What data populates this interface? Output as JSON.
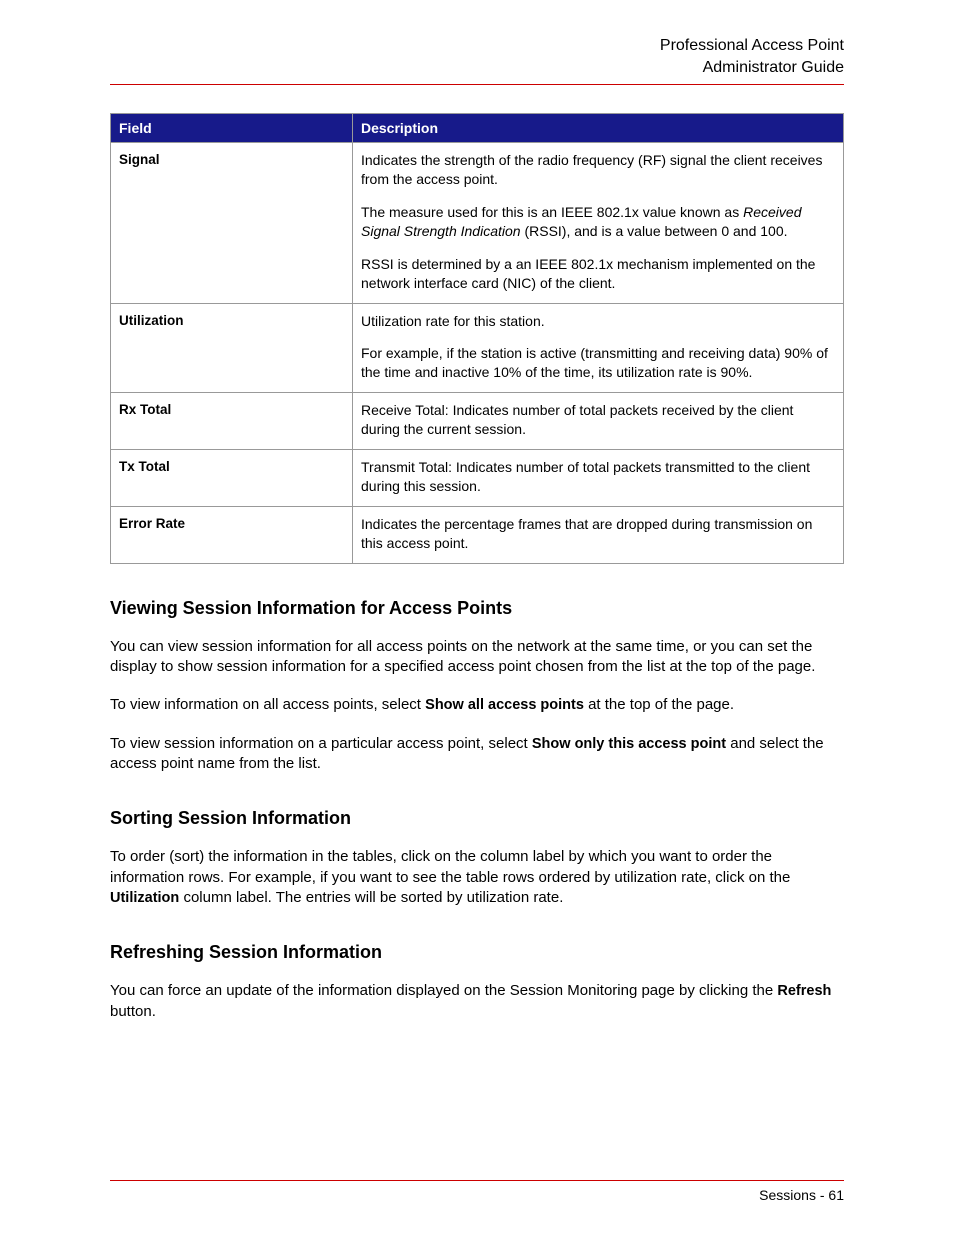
{
  "header": {
    "line1": "Professional Access Point",
    "line2": "Administrator Guide"
  },
  "table": {
    "col_field": "Field",
    "col_desc": "Description",
    "rows": [
      {
        "field": "Signal",
        "desc": [
          {
            "segments": [
              {
                "t": "Indicates the strength of the radio frequency (RF) signal the client receives from the access point."
              }
            ]
          },
          {
            "segments": [
              {
                "t": "The measure used for this is an IEEE 802.1x value known as "
              },
              {
                "t": "Received Signal Strength Indication",
                "italic": true
              },
              {
                "t": " (RSSI), and is a value between 0 and 100."
              }
            ]
          },
          {
            "segments": [
              {
                "t": "RSSI is determined by a an IEEE 802.1x mechanism implemented on the network interface card (NIC) of the client."
              }
            ]
          }
        ]
      },
      {
        "field": "Utilization",
        "desc": [
          {
            "segments": [
              {
                "t": "Utilization rate for this station."
              }
            ]
          },
          {
            "segments": [
              {
                "t": "For example, if the station is active (transmitting and receiving data) 90% of the time and inactive 10% of the time, its utilization rate is 90%."
              }
            ]
          }
        ]
      },
      {
        "field": "Rx Total",
        "desc": [
          {
            "segments": [
              {
                "t": "Receive Total: Indicates number of total packets received by the client during the current session."
              }
            ]
          }
        ]
      },
      {
        "field": "Tx Total",
        "desc": [
          {
            "segments": [
              {
                "t": "Transmit Total: Indicates number of total packets transmitted to the client during this session."
              }
            ]
          }
        ]
      },
      {
        "field": "Error Rate",
        "desc": [
          {
            "segments": [
              {
                "t": "Indicates the percentage frames that are dropped during transmission on this access point."
              }
            ]
          }
        ]
      }
    ]
  },
  "sections": [
    {
      "title": "Viewing Session Information for Access Points",
      "paras": [
        [
          {
            "t": "You can view session information for all access points on the network at the same time, or you can set the display to show session information for a specified access point chosen from the list at the top of the page."
          }
        ],
        [
          {
            "t": "To view information on all access points, select "
          },
          {
            "t": "Show all access points",
            "bold": true
          },
          {
            "t": " at the top of the page."
          }
        ],
        [
          {
            "t": "To view session information on a particular access point, select "
          },
          {
            "t": "Show only this access point",
            "bold": true
          },
          {
            "t": " and select the access point name from the list."
          }
        ]
      ]
    },
    {
      "title": "Sorting Session Information",
      "paras": [
        [
          {
            "t": "To order (sort) the information in the tables, click on the column label by which you want to order the information rows. For example, if you want to see the table rows ordered by utilization rate, click on the "
          },
          {
            "t": "Utilization",
            "bold": true
          },
          {
            "t": " column label. The entries will be sorted by utilization rate."
          }
        ]
      ]
    },
    {
      "title": "Refreshing Session Information",
      "paras": [
        [
          {
            "t": "You can force an update of the information displayed on the Session Monitoring page by clicking the "
          },
          {
            "t": "Refresh",
            "bold": true
          },
          {
            "t": " button."
          }
        ]
      ]
    }
  ],
  "footer": {
    "section": "Sessions",
    "sep": " - ",
    "page": "61"
  }
}
